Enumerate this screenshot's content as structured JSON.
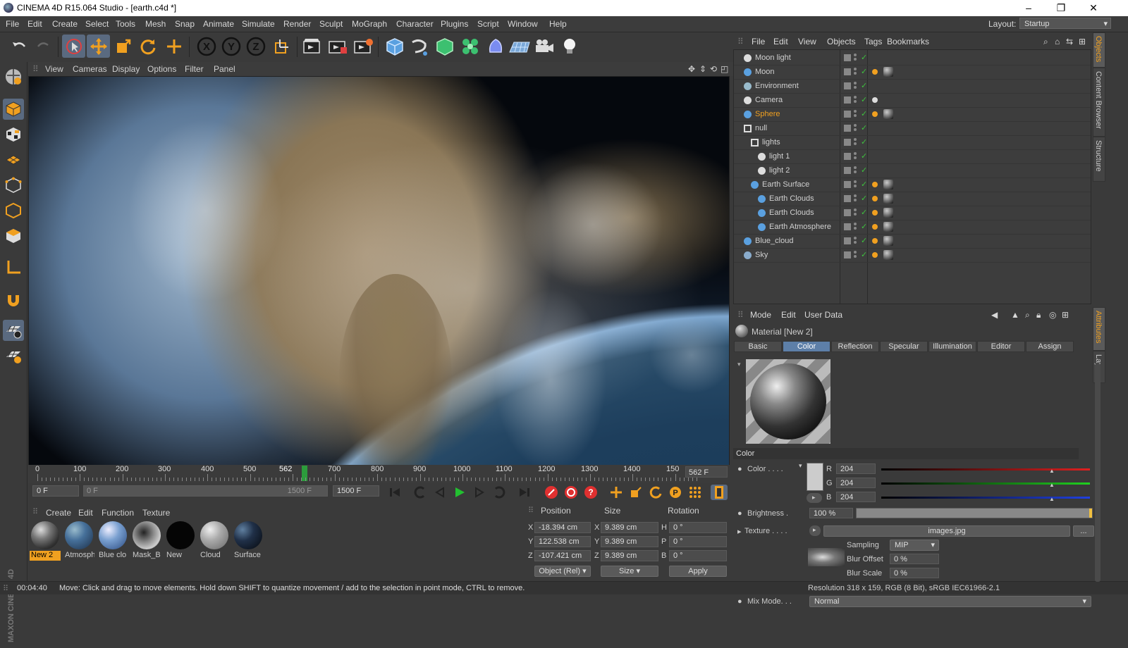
{
  "window": {
    "title": "CINEMA 4D R15.064 Studio - [earth.c4d *]",
    "min": "–",
    "max": "❐",
    "close": "✕"
  },
  "menubar": [
    "File",
    "Edit",
    "Create",
    "Select",
    "Tools",
    "Mesh",
    "Snap",
    "Animate",
    "Simulate",
    "Render",
    "Sculpt",
    "MoGraph",
    "Character",
    "Plugins",
    "Script",
    "Window",
    "Help"
  ],
  "layout": {
    "label": "Layout:",
    "value": "Startup"
  },
  "toolbar": {
    "icons": [
      "undo-icon",
      "redo-icon",
      "live-selection-icon",
      "move-icon",
      "scale-icon",
      "rotate-icon",
      "add-object-icon",
      "x-axis-icon",
      "y-axis-icon",
      "z-axis-icon",
      "coordinate-system-icon",
      "render-view-icon",
      "render-picture-viewer-icon",
      "render-settings-icon",
      "cube-icon",
      "pen-spline-icon",
      "subdivision-icon",
      "cloner-icon",
      "deformer-icon",
      "floor-icon",
      "camera-icon",
      "light-icon"
    ],
    "x": "X",
    "y": "Y",
    "z": "Z"
  },
  "viewport_menu": [
    "View",
    "Cameras",
    "Display",
    "Options",
    "Filter",
    "Panel"
  ],
  "timeline": {
    "ticks": [
      "0",
      "100",
      "200",
      "300",
      "400",
      "500",
      "562",
      "700",
      "800",
      "900",
      "1000",
      "1100",
      "1200",
      "1300",
      "1400",
      "150"
    ],
    "playhead": "562",
    "current_frame": "562 F"
  },
  "transport": {
    "start": "0 F",
    "range_start": "0 F",
    "range_end": "1500 F",
    "end": "1500 F"
  },
  "material_menu": [
    "Create",
    "Edit",
    "Function",
    "Texture"
  ],
  "materials": [
    {
      "name": "New 2",
      "selected": true
    },
    {
      "name": "Atmosph",
      "selected": false
    },
    {
      "name": "Blue clo",
      "selected": false
    },
    {
      "name": "Mask_B",
      "selected": false
    },
    {
      "name": "New",
      "selected": false
    },
    {
      "name": "Cloud",
      "selected": false
    },
    {
      "name": "Surface",
      "selected": false
    }
  ],
  "coordinates": {
    "headers": [
      "Position",
      "Size",
      "Rotation"
    ],
    "rows": [
      {
        "axis": "X",
        "pos": "-18.394 cm",
        "saxis": "X",
        "size": "9.389 cm",
        "raxis": "H",
        "rot": "0 °"
      },
      {
        "axis": "Y",
        "pos": "122.538 cm",
        "saxis": "Y",
        "size": "9.389 cm",
        "raxis": "P",
        "rot": "0 °"
      },
      {
        "axis": "Z",
        "pos": "-107.421 cm",
        "saxis": "Z",
        "size": "9.389 cm",
        "raxis": "B",
        "rot": "0 °"
      }
    ],
    "mode": "Object (Rel)",
    "size_mode": "Size",
    "apply": "Apply"
  },
  "status": {
    "time": "00:04:40",
    "message": "Move: Click and drag to move elements. Hold down SHIFT to quantize movement / add to the selection in point mode, CTRL to remove."
  },
  "object_menu": [
    "File",
    "Edit",
    "View",
    "Objects",
    "Tags",
    "Bookmarks"
  ],
  "objects": [
    {
      "name": "Moon light",
      "indent": 0,
      "type": "light"
    },
    {
      "name": "Moon",
      "indent": 0,
      "type": "sphere"
    },
    {
      "name": "Environment",
      "indent": 0,
      "type": "env"
    },
    {
      "name": "Camera",
      "indent": 0,
      "type": "camera"
    },
    {
      "name": "Sphere",
      "indent": 0,
      "type": "sphere",
      "highlight": true
    },
    {
      "name": "null",
      "indent": 0,
      "type": "null"
    },
    {
      "name": "lights",
      "indent": 1,
      "type": "null"
    },
    {
      "name": "light 1",
      "indent": 2,
      "type": "light"
    },
    {
      "name": "light 2",
      "indent": 2,
      "type": "light"
    },
    {
      "name": "Earth Surface",
      "indent": 1,
      "type": "sphere"
    },
    {
      "name": "Earth Clouds",
      "indent": 2,
      "type": "sphere"
    },
    {
      "name": "Earth Clouds",
      "indent": 2,
      "type": "sphere"
    },
    {
      "name": "Earth Atmosphere",
      "indent": 2,
      "type": "sphere"
    },
    {
      "name": "Blue_cloud",
      "indent": 0,
      "type": "plane"
    },
    {
      "name": "Sky",
      "indent": 0,
      "type": "sky"
    }
  ],
  "side_tabs": {
    "objects": "Objects",
    "content": "Content Browser",
    "structure": "Structure",
    "attributes": "Attributes",
    "layers": "Layers"
  },
  "attr_menu": [
    "Mode",
    "Edit",
    "User Data"
  ],
  "attributes": {
    "material_title": "Material [New 2]",
    "tabs": [
      "Basic",
      "Color",
      "Reflection",
      "Specular",
      "Illumination",
      "Editor",
      "Assign"
    ],
    "selected_tab": "Color",
    "section": "Color",
    "color_label": "Color . . . .",
    "r_label": "R",
    "g_label": "G",
    "b_label": "B",
    "r": "204",
    "g": "204",
    "b": "204",
    "brightness_label": "Brightness .",
    "brightness": "100 %",
    "texture_label": "Texture . . . .",
    "texture_file": "images.jpg",
    "texture_more": "...",
    "sampling_label": "Sampling",
    "sampling": "MIP",
    "blur_offset_label": "Blur Offset",
    "blur_offset": "0 %",
    "blur_scale_label": "Blur Scale",
    "blur_scale": "0 %",
    "resolution": "Resolution 318 x 159, RGB (8 Bit), sRGB IEC61966-2.1",
    "mix_mode_label": "Mix Mode. . .",
    "mix_mode": "Normal"
  }
}
